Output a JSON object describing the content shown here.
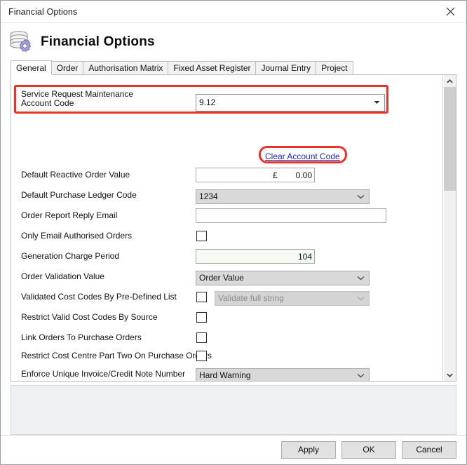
{
  "window": {
    "title": "Financial Options",
    "close_icon": "close-icon"
  },
  "banner": {
    "title": "Financial Options",
    "icon": "financial-options-icon"
  },
  "tabs": [
    {
      "label": "General",
      "active": true
    },
    {
      "label": "Order",
      "active": false
    },
    {
      "label": "Authorisation Matrix",
      "active": false
    },
    {
      "label": "Fixed Asset Register",
      "active": false
    },
    {
      "label": "Journal Entry",
      "active": false
    },
    {
      "label": "Project",
      "active": false
    }
  ],
  "form": {
    "service_request": {
      "label": "Service Request Maintenance\nAccount Code",
      "value": "9.12",
      "highlighted": true
    },
    "clear_account_code": {
      "label": "Clear Account Code",
      "highlighted": true
    },
    "default_reactive_order_value": {
      "label": "Default Reactive Order Value",
      "currency": "£",
      "value": "0.00"
    },
    "default_purchase_ledger_code": {
      "label": "Default Purchase Ledger Code",
      "value": "1234"
    },
    "order_report_reply_email": {
      "label": "Order Report Reply Email",
      "value": "",
      "placeholder": ""
    },
    "only_email_authorised_orders": {
      "label": "Only Email Authorised Orders",
      "checked": false
    },
    "generation_charge_period": {
      "label": "Generation Charge Period",
      "value": "104"
    },
    "order_validation_value": {
      "label": "Order Validation Value",
      "value": "Order Value"
    },
    "validated_cost_codes_by_pre_defined_list": {
      "label": "Validated Cost Codes By Pre-Defined List",
      "checked": false,
      "dropdown_value": "Validate full string",
      "dropdown_disabled": true
    },
    "restrict_valid_cost_codes_by_source": {
      "label": "Restrict Valid Cost Codes By Source",
      "checked": false
    },
    "link_orders_to_purchase_orders": {
      "label": "Link Orders To Purchase Orders",
      "checked": false
    },
    "restrict_cost_centre_part_two": {
      "label": "Restrict Cost Centre Part Two On Purchase Orders",
      "checked": false
    },
    "enforce_unique_invoice": {
      "label": "Enforce Unique Invoice/Credit Note Number",
      "value": "Hard Warning"
    }
  },
  "scrollbar": {
    "up_icon": "chevron-up-icon",
    "down_icon": "chevron-down-icon"
  },
  "buttons": {
    "apply": "Apply",
    "ok": "OK",
    "cancel": "Cancel"
  },
  "colors": {
    "highlight": "#ee3124",
    "link": "#1a28c8",
    "combo_bg": "#d9d9d9",
    "green_field": "#f3faf0"
  }
}
